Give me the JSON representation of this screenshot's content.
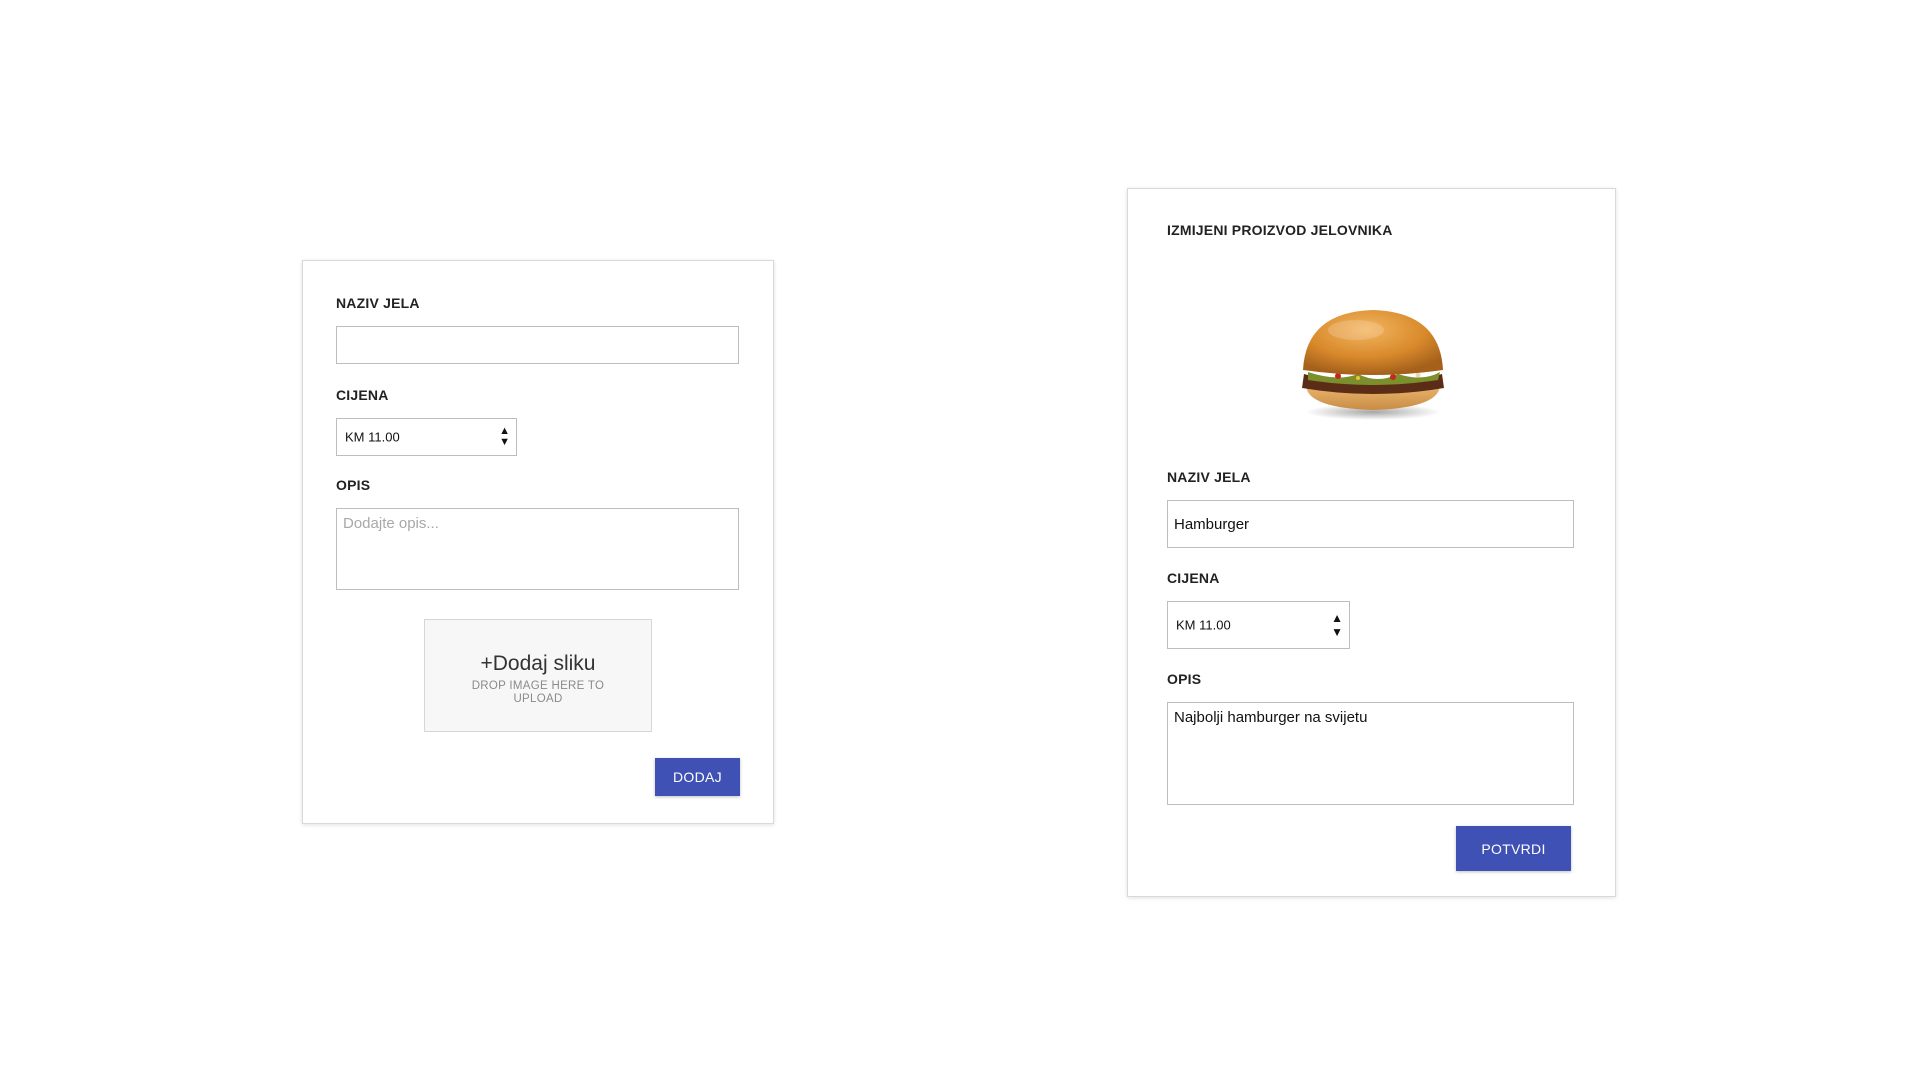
{
  "add_form": {
    "name_label": "NAZIV JELA",
    "name_value": "",
    "price_label": "CIJENA",
    "price_value": "KM 11.00",
    "description_label": "OPIS",
    "description_placeholder": "Dodajte opis...",
    "dropzone_title": "+Dodaj sliku",
    "dropzone_subtitle": "DROP IMAGE HERE TO UPLOAD",
    "submit_label": "DODAJ"
  },
  "edit_form": {
    "title": "IZMIJENI PROIZVOD JELOVNIKA",
    "image_alt": "hamburger-image",
    "name_label": "NAZIV JELA",
    "name_value": "Hamburger",
    "price_label": "CIJENA",
    "price_value": "KM 11.00",
    "description_label": "OPIS",
    "description_value": "Najbolji hamburger na svijetu",
    "submit_label": "POTVRDI"
  },
  "icons": {
    "spinner_up": "▲",
    "spinner_down": "▼"
  },
  "colors": {
    "primary": "#3f51b5",
    "border": "#bdbdbd",
    "dropzone_bg": "#f7f7f7"
  }
}
